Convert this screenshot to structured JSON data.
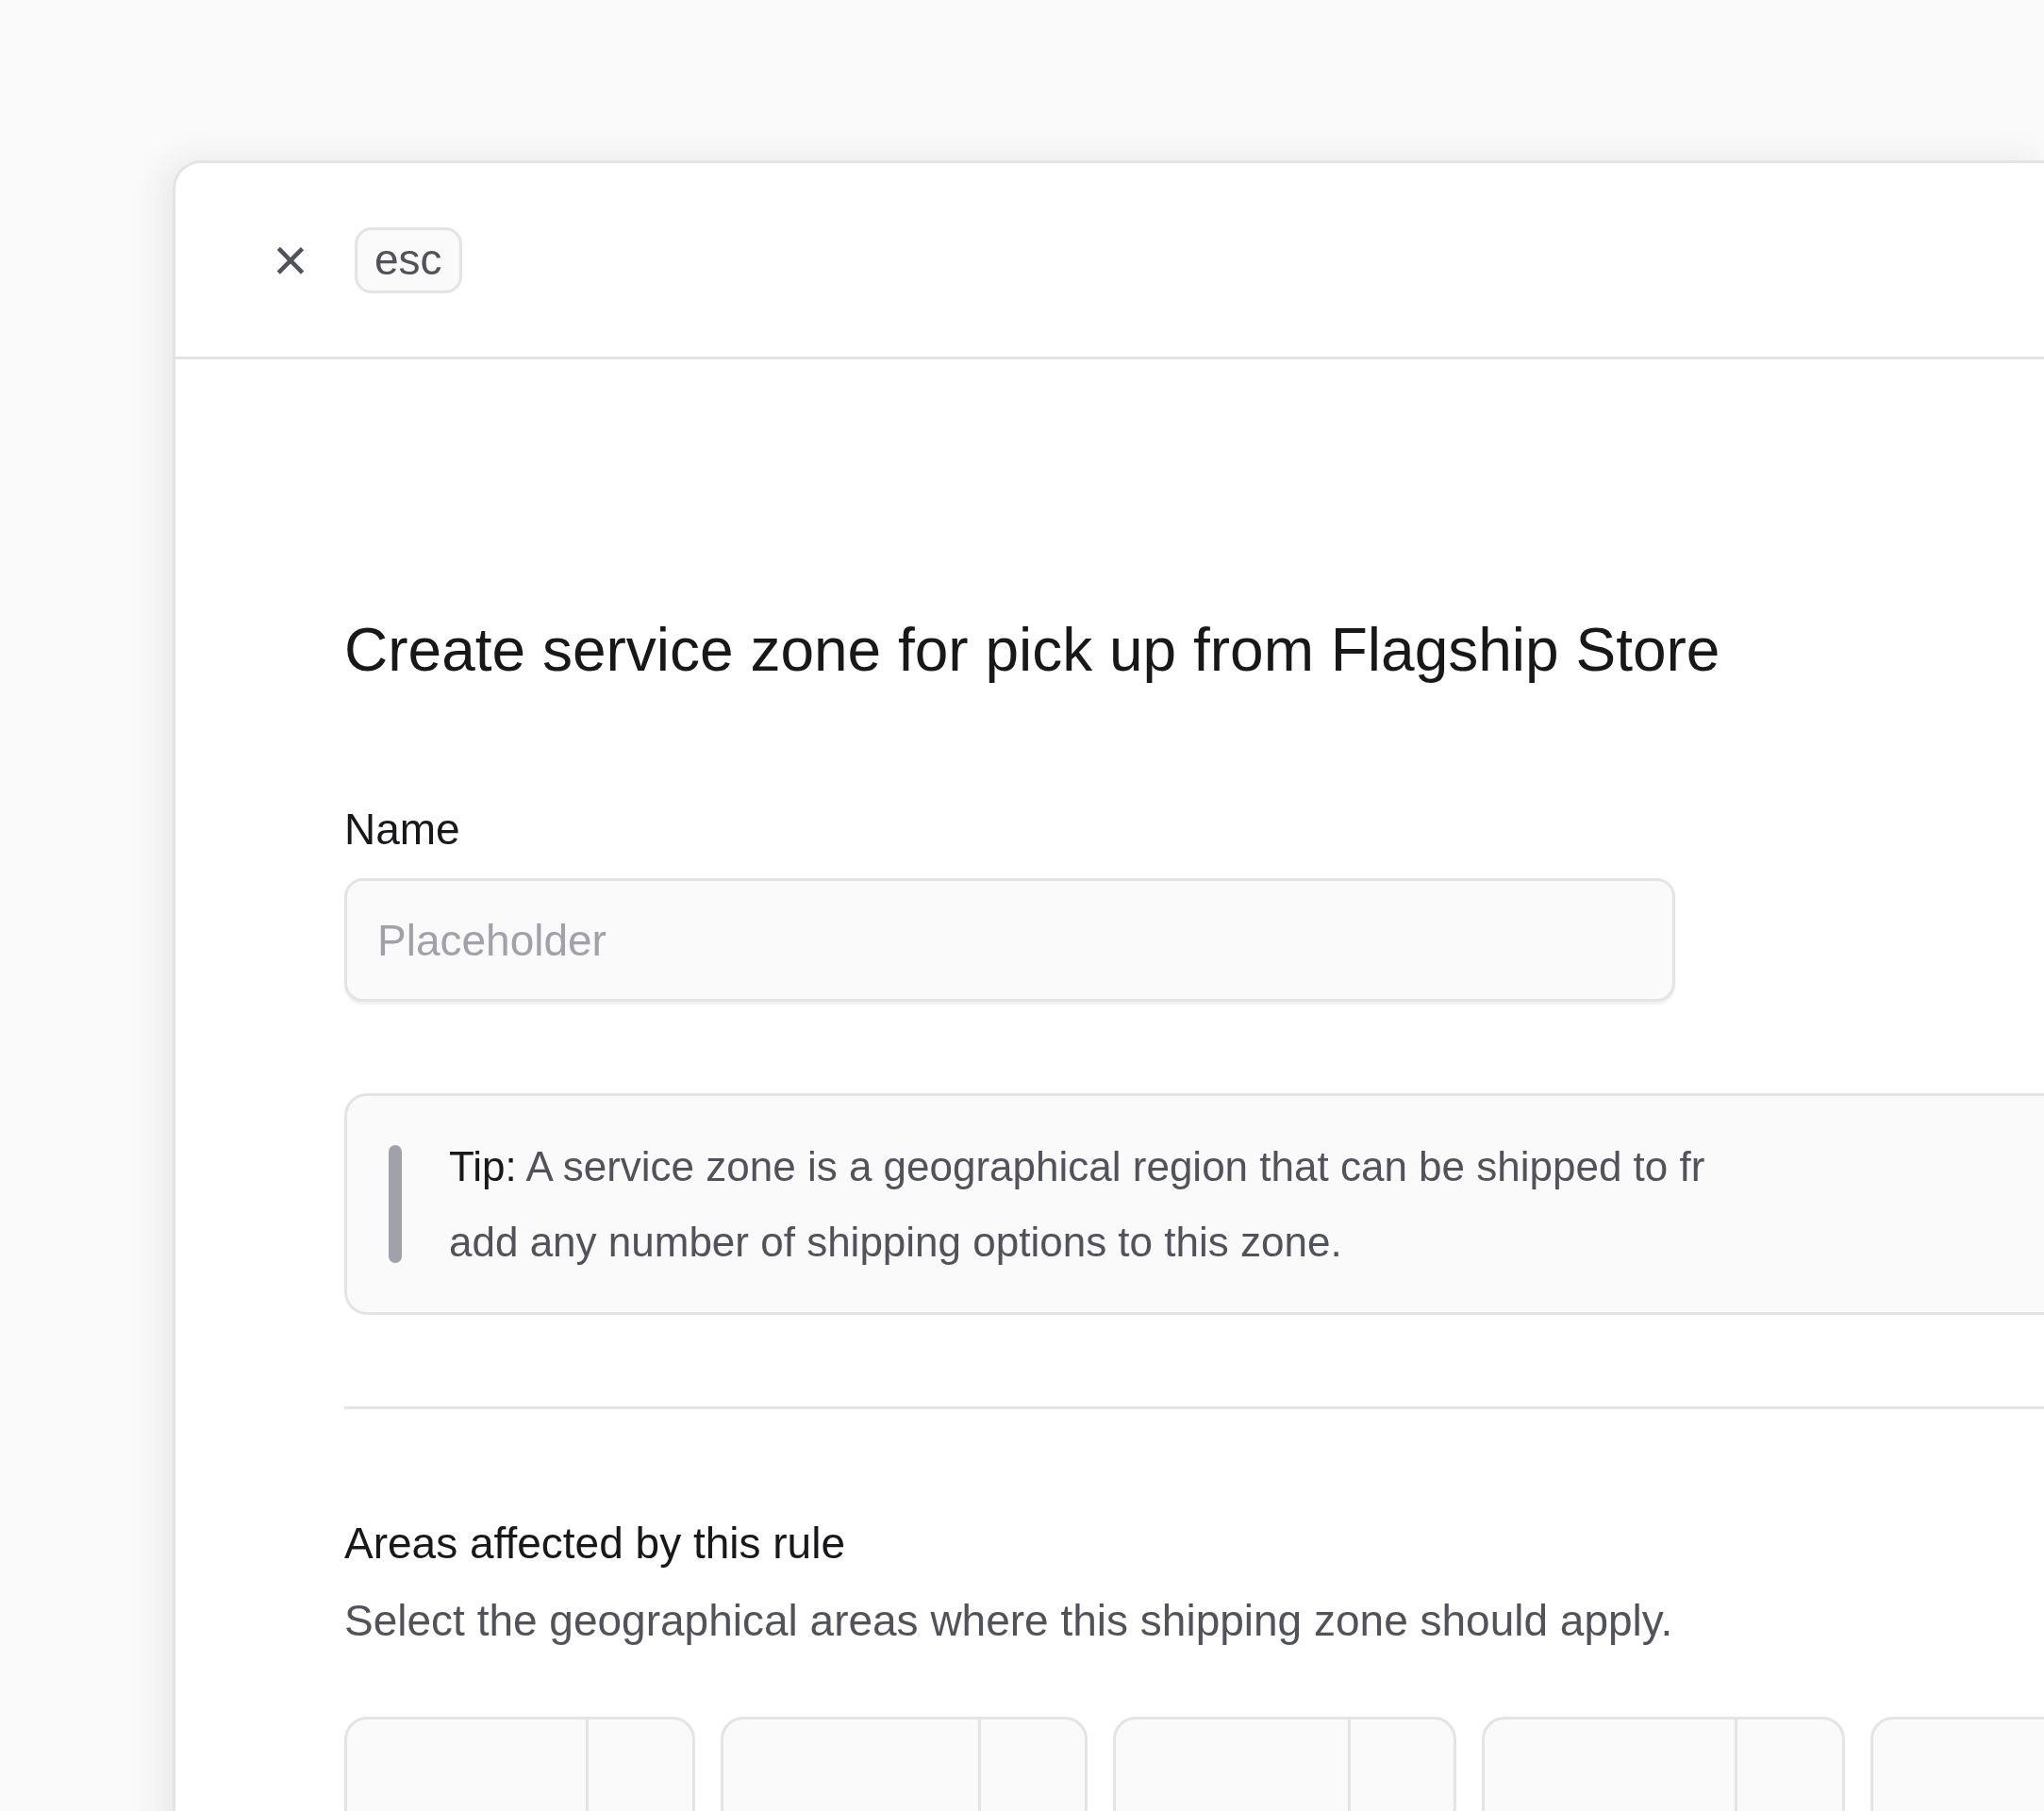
{
  "header": {
    "close_label": "×",
    "shortcut": "esc"
  },
  "title": "Create service zone for pick up from Flagship Store",
  "name_field": {
    "label": "Name",
    "placeholder": "Placeholder"
  },
  "tip": {
    "label": "Tip:",
    "lines": [
      "A service zone is a geographical region that can be shipped to fr",
      "add any number of shipping options to this zone."
    ]
  },
  "areas": {
    "title": "Areas affected by this rule",
    "description": "Select the geographical areas where this shipping zone should apply.",
    "selectors": [
      {
        "kind": "select"
      },
      {
        "kind": "select"
      },
      {
        "kind": "select"
      },
      {
        "kind": "select"
      },
      {
        "kind": "select"
      }
    ]
  }
}
